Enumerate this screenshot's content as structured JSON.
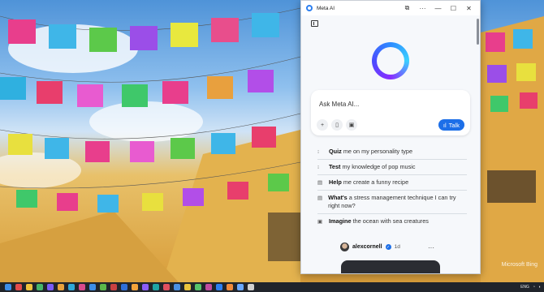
{
  "window": {
    "title": "Meta AI",
    "controls": [
      "pin",
      "more",
      "minimize",
      "maximize",
      "close"
    ]
  },
  "ask": {
    "placeholder": "Ask Meta AI...",
    "tools": [
      "add",
      "attach-file",
      "image"
    ],
    "talk_label": "Talk"
  },
  "suggestions": [
    {
      "bold": "Quiz",
      "text": " me on my personality type",
      "icon": "quiz-icon"
    },
    {
      "bold": "Test",
      "text": " my knowledge of pop music",
      "icon": "test-icon"
    },
    {
      "bold": "Help",
      "text": " me create a funny recipe",
      "icon": "help-icon"
    },
    {
      "bold": "What's",
      "text": " a stress management technique I can try right now?",
      "icon": "question-icon"
    },
    {
      "bold": "Imagine",
      "text": " the ocean with sea creatures",
      "icon": "imagine-icon"
    }
  ],
  "post": {
    "handle": "alexcornell",
    "time": "1d"
  },
  "desktop": {
    "watermark": "Microsoft Bing"
  },
  "taskbar": {
    "language": "ENG",
    "icon_colors": [
      "#3d8ee8",
      "#e24b4b",
      "#f0c23b",
      "#46b56a",
      "#7a5af8",
      "#e8a23d",
      "#2fa7d8",
      "#d94a8c",
      "#3d8ee8",
      "#5bb84a",
      "#c94141",
      "#2f6fd8",
      "#f3a33a",
      "#8b5cf6",
      "#20a4a4",
      "#e04f5f",
      "#4a90e2",
      "#e8c23d",
      "#57c26a",
      "#c04b9f",
      "#2d7ff0",
      "#f08a3b",
      "#6aa8ff",
      "#d0d0d0"
    ]
  },
  "colors": {
    "accent": "#1d6fe8",
    "taskbar": "#20242b"
  }
}
